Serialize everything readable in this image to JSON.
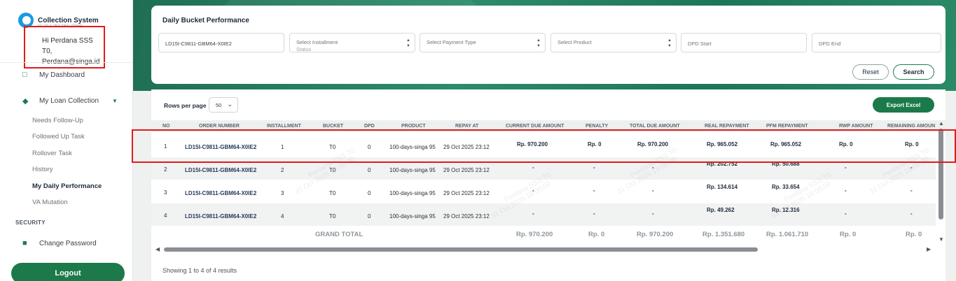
{
  "app": {
    "title": "Collection System",
    "subtitle": "10.10.1.253 DEV (SSH)"
  },
  "user": {
    "greeting": "Hi Perdana SSS T0,",
    "email": "Perdana@singa.id"
  },
  "sidebar": {
    "items": [
      {
        "label": "My Dashboard",
        "icon": "laptop-icon"
      },
      {
        "label": "My Loan Collection",
        "icon": "layers-icon"
      }
    ],
    "subitems": [
      "Needs Follow-Up",
      "Followed Up Task",
      "Rollover Task",
      "History",
      "My Daily Performance",
      "VA Mutation"
    ],
    "active_subitem": "My Daily Performance",
    "security_label": "SECURITY",
    "change_password": "Change Password",
    "logout": "Logout"
  },
  "filters": {
    "title": "Daily Bucket Performance",
    "order_number_value": "LD15I-C9811-GBM64-X0IE2",
    "installment_status_placeholder": "Select Installment",
    "installment_status_placeholder_2": "Status",
    "payment_type_placeholder": "Select Payment Type",
    "product_placeholder": "Select Product",
    "dpd_start_placeholder": "DPD Start",
    "dpd_end_placeholder": "DPD End",
    "reset_label": "Reset",
    "search_label": "Search"
  },
  "table": {
    "rows_per_page_label": "Rows per page",
    "rows_per_page_value": "50",
    "export_label": "Export Excel",
    "columns": [
      "NO",
      "ORDER NUMBER",
      "INSTALLMENT",
      "BUCKET",
      "DPD",
      "PRODUCT",
      "REPAY AT",
      "CURRENT DUE AMOUNT",
      "PENALTY",
      "TOTAL DUE AMOUNT",
      "REAL REPAYMENT",
      "PFM REPAYMENT",
      "RWP AMOUNT",
      "REMAINING AMOUN"
    ],
    "rows": [
      {
        "no": "1",
        "order": "LD15I-C9811-GBM64-X0IE2",
        "installment": "1",
        "bucket": "T0",
        "dpd": "0",
        "product": "100-days-singa 95",
        "repay_at": "29 Oct 2025 23:12",
        "current_due": "Rp. 970.200",
        "penalty": "Rp. 0",
        "total_due": "Rp. 970.200",
        "real_repayment": "Rp. 965.052",
        "pfm_repayment": "Rp. 965.052",
        "rwp_amount": "Rp. 0",
        "remaining": "Rp. 0"
      },
      {
        "no": "2",
        "order": "LD15I-C9811-GBM64-X0IE2",
        "installment": "2",
        "bucket": "T0",
        "dpd": "0",
        "product": "100-days-singa 95",
        "repay_at": "29 Oct 2025 23:12",
        "current_due": "-",
        "penalty": "-",
        "total_due": "-",
        "real_repayment": "Rp. 202.752",
        "pfm_repayment": "Rp. 50.688",
        "rwp_amount": "-",
        "remaining": "-"
      },
      {
        "no": "3",
        "order": "LD15I-C9811-GBM64-X0IE2",
        "installment": "3",
        "bucket": "T0",
        "dpd": "0",
        "product": "100-days-singa 95",
        "repay_at": "29 Oct 2025 23:12",
        "current_due": "-",
        "penalty": "-",
        "total_due": "-",
        "real_repayment": "Rp. 134.614",
        "pfm_repayment": "Rp. 33.654",
        "rwp_amount": "-",
        "remaining": "-"
      },
      {
        "no": "4",
        "order": "LD15I-C9811-GBM64-X0IE2",
        "installment": "4",
        "bucket": "T0",
        "dpd": "0",
        "product": "100-days-singa 95",
        "repay_at": "29 Oct 2025 23:12",
        "current_due": "-",
        "penalty": "-",
        "total_due": "-",
        "real_repayment": "Rp. 49.262",
        "pfm_repayment": "Rp. 12.316",
        "rwp_amount": "-",
        "remaining": "-"
      }
    ],
    "grand_total": {
      "label": "GRAND TOTAL",
      "current_due": "Rp. 970.200",
      "penalty": "Rp. 0",
      "total_due": "Rp. 970.200",
      "real_repayment": "Rp. 1.351.680",
      "pfm_repayment": "Rp. 1.061.710",
      "rwp_amount": "Rp. 0",
      "remaining": "Rp. 0"
    },
    "showing_text": "Showing 1 to 4 of 4 results",
    "watermark_name": "Perdana SSS T0",
    "watermark_date": "31 Oct 2025 19:00:00"
  },
  "colors": {
    "brand_green": "#1c7a4a",
    "highlight_red": "#e01b1b",
    "header_green": "#2d8c6a"
  }
}
